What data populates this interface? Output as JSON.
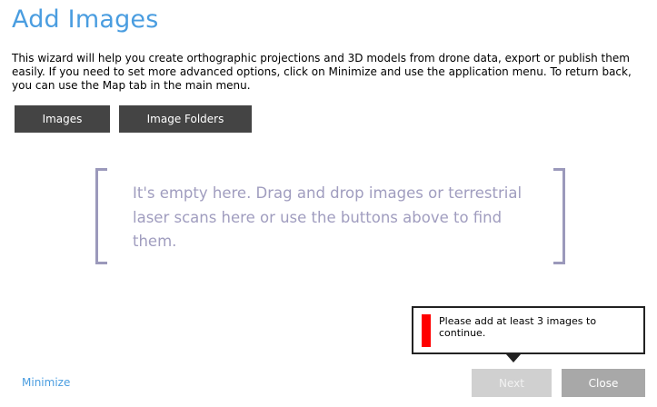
{
  "header": {
    "title": "Add Images",
    "description": "This wizard will help you create orthographic projections and 3D models from drone data, export or publish them easily. If you need to set more advanced options, click on Minimize and use the application menu. To return back, you can use the Map tab in the main menu."
  },
  "toolbar": {
    "images_label": "Images",
    "image_folders_label": "Image Folders"
  },
  "drop_zone": {
    "message": "It's empty here. Drag and drop images or terrestrial laser scans here or use the buttons above to find them."
  },
  "tooltip": {
    "message": "Please add at least 3 images to continue.",
    "indicator_color": "#ff0000"
  },
  "footer": {
    "minimize_label": "Minimize",
    "next_label": "Next",
    "close_label": "Close"
  },
  "colors": {
    "accent": "#4a9de0",
    "dark_button": "#444444",
    "drop_zone": "#9b99bb"
  }
}
